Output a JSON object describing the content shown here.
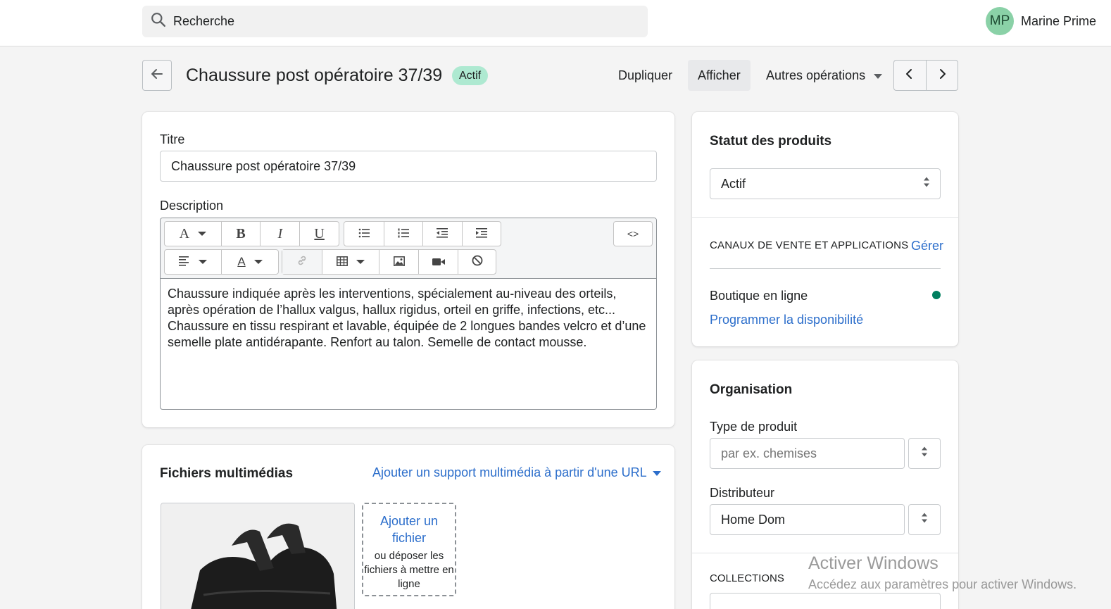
{
  "topbar": {
    "search_placeholder": "Recherche",
    "user_initials": "MP",
    "user_name": "Marine Prime"
  },
  "header": {
    "title": "Chaussure post opératoire 37/39",
    "status": "Actif",
    "duplicate_label": "Dupliquer",
    "view_label": "Afficher",
    "more_label": "Autres opérations"
  },
  "product": {
    "title_label": "Titre",
    "title_value": "Chaussure post opératoire 37/39",
    "description_label": "Description",
    "description_text": "Chaussure indiquée après les interventions, spécialement au-niveau des orteils, après opération de l’hallux valgus, hallux rigidus, orteil en griffe, infections, etc... Chaussure en tissu respirant et lavable, équipée de 2 longues bandes velcro et d’une semelle plate antidérapante. Renfort au talon. Semelle de contact mousse.",
    "toolbar": {
      "font": "A",
      "bold": "B",
      "italic": "I",
      "underline": "U",
      "html": "<>",
      "text_color": "A"
    }
  },
  "media": {
    "title": "Fichiers multimédias",
    "add_url_label": "Ajouter un support multimédia à partir d'une URL",
    "upload_link": "Ajouter un fichier",
    "upload_hint": "ou déposer les fichiers à mettre en ligne"
  },
  "status_card": {
    "title": "Statut des produits",
    "selected": "Actif",
    "channels_heading": "CANAUX DE VENTE ET APPLICATIONS",
    "manage_label": "Gérer",
    "channel_name": "Boutique en ligne",
    "schedule_label": "Programmer la disponibilité",
    "channel_dot_color": "#007f5f"
  },
  "organisation": {
    "title": "Organisation",
    "type_label": "Type de produit",
    "type_placeholder": "par ex. chemises",
    "vendor_label": "Distributeur",
    "vendor_value": "Home Dom",
    "collections_heading": "COLLECTIONS"
  },
  "watermark": {
    "title": "Activer Windows",
    "subtitle": "Accédez aux paramètres pour activer Windows."
  },
  "colors": {
    "accent_link": "#2c6ecb",
    "badge_bg": "#aee9d1",
    "avatar_bg": "#8ad1a7"
  }
}
